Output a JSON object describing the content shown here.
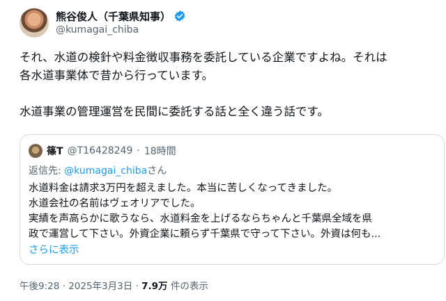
{
  "author": {
    "display_name": "熊谷俊人（千葉県知事）",
    "handle": "@kumagai_chiba"
  },
  "tweet": {
    "lines": [
      "それ、水道の検針や料金徴収事務を委託している企業ですよね。それは",
      "各水道事業体で昔から行っています。",
      "水道事業の管理運営を民間に委託する話と全く違う話です。"
    ]
  },
  "quoted": {
    "name": "篠T",
    "handle": "@T16428249",
    "separator": "·",
    "time": "18時間",
    "reply_to_prefix": "返信先: ",
    "reply_to_mention": "@kumagai_chiba",
    "reply_to_suffix": "さん",
    "lines": [
      "水道料金は請求3万円を超えました。本当に苦しくなってきました。",
      "水道会社の名前はヴェオリアでした。",
      "実績を声高らかに歌うなら、水道料金を上げるならちゃんと千葉県全域を県",
      "政で運営して下さい。外資企業に頼らず千葉県で守って下さい。外資は何も..."
    ],
    "show_more": "さらに表示"
  },
  "meta": {
    "time": "午後9:28",
    "separator": " · ",
    "date": "2025年3月3日",
    "separator2": " · ",
    "views": "7.9万",
    "views_label": " 件の表示"
  },
  "colors": {
    "accent": "#1d9bf0",
    "muted": "#536471",
    "text": "#0f1419",
    "border": "#cfd9de"
  },
  "icons": {
    "verified": "verified-badge-icon"
  }
}
